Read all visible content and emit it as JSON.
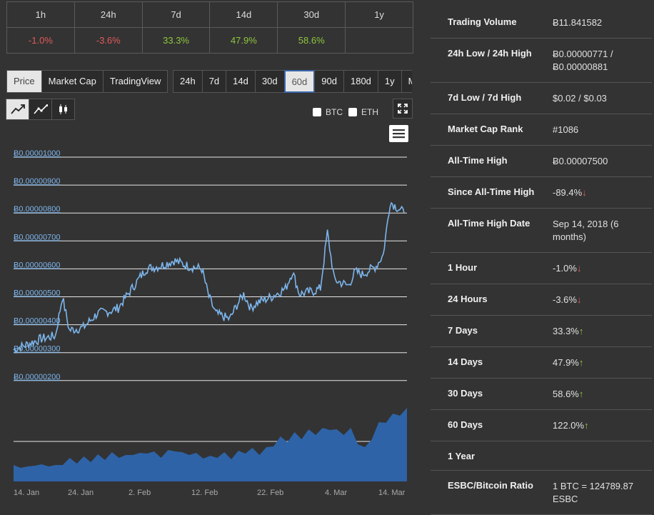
{
  "changes": {
    "headers": [
      "1h",
      "24h",
      "7d",
      "14d",
      "30d",
      "1y"
    ],
    "values": [
      "-1.0%",
      "-3.6%",
      "33.3%",
      "47.9%",
      "58.6%",
      ""
    ],
    "status": [
      "neg",
      "neg",
      "pos",
      "pos",
      "pos",
      ""
    ]
  },
  "view_tabs": [
    "Price",
    "Market Cap",
    "TradingView"
  ],
  "range_tabs": [
    "24h",
    "7d",
    "14d",
    "30d",
    "60d",
    "90d",
    "180d",
    "1y",
    "Max"
  ],
  "selected_range": "60d",
  "compare": {
    "btc": "BTC",
    "eth": "ETH"
  },
  "icons": {
    "expand": "expand-icon",
    "menu": "hamburger-menu-icon",
    "line": "line-chart-icon",
    "ohlc": "ohlc-chart-icon",
    "candle": "candlestick-icon"
  },
  "chart_data": {
    "type": "line",
    "y_ticks": [
      "Ƀ0.00001000",
      "Ƀ0.00000900",
      "Ƀ0.00000800",
      "Ƀ0.00000700",
      "Ƀ0.00000600",
      "Ƀ0.00000500",
      "Ƀ0.00000400",
      "Ƀ0.00000300",
      "Ƀ0.00000200"
    ],
    "ylim": [
      2e-06,
      1e-05
    ],
    "x_ticks": [
      "14. Jan",
      "24. Jan",
      "2. Feb",
      "12. Feb",
      "22. Feb",
      "4. Mar",
      "14. Mar"
    ],
    "price_series": [
      [
        0,
        3.1e-06
      ],
      [
        2,
        3.3e-06
      ],
      [
        4,
        3.5e-06
      ],
      [
        6,
        3.6e-06
      ],
      [
        7,
        5e-06
      ],
      [
        8,
        3.8e-06
      ],
      [
        10,
        3.9e-06
      ],
      [
        12,
        4.4e-06
      ],
      [
        14,
        4.5e-06
      ],
      [
        15,
        4.6e-06
      ],
      [
        17,
        5.3e-06
      ],
      [
        19,
        6e-06
      ],
      [
        21,
        6.1e-06
      ],
      [
        23,
        6.3e-06
      ],
      [
        25,
        6.1e-06
      ],
      [
        27,
        6e-06
      ],
      [
        28,
        5e-06
      ],
      [
        29,
        4.4e-06
      ],
      [
        30,
        4.3e-06
      ],
      [
        31,
        4.2e-06
      ],
      [
        32,
        4.7e-06
      ],
      [
        33,
        5.1e-06
      ],
      [
        34,
        4.6e-06
      ],
      [
        35,
        4.8e-06
      ],
      [
        37,
        5e-06
      ],
      [
        39,
        5.3e-06
      ],
      [
        40,
        5.9e-06
      ],
      [
        41,
        5.1e-06
      ],
      [
        43,
        5.2e-06
      ],
      [
        44,
        5.3e-06
      ],
      [
        45,
        7.3e-06
      ],
      [
        46,
        5.6e-06
      ],
      [
        47,
        5.5e-06
      ],
      [
        48,
        5.4e-06
      ],
      [
        49,
        5.9e-06
      ],
      [
        50,
        5.8e-06
      ],
      [
        52,
        6.1e-06
      ],
      [
        53,
        6.5e-06
      ],
      [
        54,
        8.4e-06
      ],
      [
        55,
        8.2e-06
      ],
      [
        56,
        8e-06
      ]
    ],
    "volume_series": [
      0.2,
      0.22,
      0.18,
      0.25,
      0.21,
      0.24,
      0.2,
      0.26,
      0.3,
      0.28,
      0.32,
      0.3,
      0.35,
      0.33,
      0.38,
      0.36,
      0.34,
      0.4,
      0.37,
      0.42,
      0.39,
      0.36,
      0.41,
      0.45,
      0.38,
      0.4,
      0.37,
      0.35,
      0.33,
      0.36,
      0.38,
      0.34,
      0.4,
      0.42,
      0.44,
      0.4,
      0.45,
      0.52,
      0.6,
      0.58,
      0.66,
      0.62,
      0.7,
      0.68,
      0.72,
      0.75,
      0.7,
      0.68,
      0.72,
      0.55,
      0.45,
      0.62,
      0.8,
      0.85,
      0.92,
      0.95,
      1.0
    ]
  },
  "stats": [
    {
      "label": "Trading Volume",
      "value": "Ƀ11.841582",
      "status": ""
    },
    {
      "label": "24h Low / 24h High",
      "value": "Ƀ0.00000771 / Ƀ0.00000881",
      "status": ""
    },
    {
      "label": "7d Low / 7d High",
      "value": "$0.02 / $0.03",
      "status": ""
    },
    {
      "label": "Market Cap Rank",
      "value": "#1086",
      "status": ""
    },
    {
      "label": "All-Time High",
      "value": "Ƀ0.00007500",
      "status": ""
    },
    {
      "label": "Since All-Time High",
      "value": "-89.4%",
      "status": "neg"
    },
    {
      "label": "All-Time High Date",
      "value": "Sep 14, 2018 (6 months)",
      "status": ""
    },
    {
      "label": "1 Hour",
      "value": "-1.0%",
      "status": "neg"
    },
    {
      "label": "24 Hours",
      "value": "-3.6%",
      "status": "neg"
    },
    {
      "label": "7 Days",
      "value": "33.3%",
      "status": "pos"
    },
    {
      "label": "14 Days",
      "value": "47.9%",
      "status": "pos"
    },
    {
      "label": "30 Days",
      "value": "58.6%",
      "status": "pos"
    },
    {
      "label": "60 Days",
      "value": "122.0%",
      "status": "pos"
    },
    {
      "label": "1 Year",
      "value": "",
      "status": ""
    },
    {
      "label": "ESBC/Bitcoin Ratio",
      "value": "1 BTC = 124789.87 ESBC",
      "status": ""
    }
  ],
  "colors": {
    "line": "#7cb5ec",
    "volume": "#2e63a8",
    "negative": "#e15a5a",
    "positive": "#8fc73e"
  }
}
